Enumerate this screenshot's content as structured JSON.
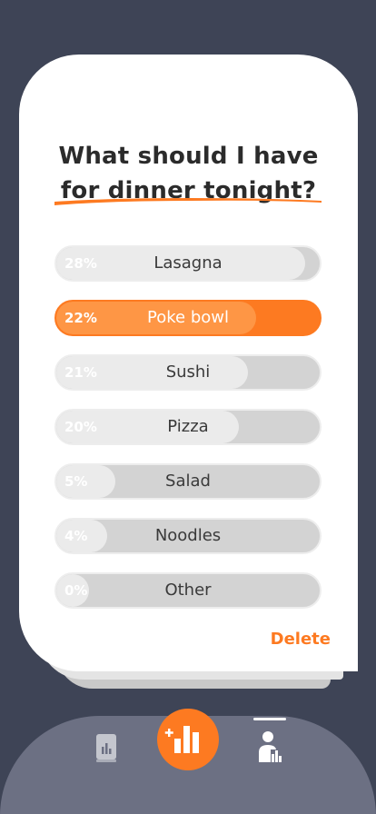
{
  "poll": {
    "question_line1": "What should I have",
    "question_line2": "for dinner tonight?",
    "options": [
      {
        "label": "Lasagna",
        "percent_text": "28%",
        "percent": 28,
        "selected": false
      },
      {
        "label": "Poke bowl",
        "percent_text": "22%",
        "percent": 22,
        "selected": true
      },
      {
        "label": "Sushi",
        "percent_text": "21%",
        "percent": 21,
        "selected": false
      },
      {
        "label": "Pizza",
        "percent_text": "20%",
        "percent": 20,
        "selected": false
      },
      {
        "label": "Salad",
        "percent_text": "5%",
        "percent": 5,
        "selected": false
      },
      {
        "label": "Noodles",
        "percent_text": "4%",
        "percent": 4,
        "selected": false
      },
      {
        "label": "Other",
        "percent_text": "0%",
        "percent": 0,
        "selected": false
      }
    ],
    "delete_label": "Delete"
  },
  "tabbar": {
    "items": [
      {
        "icon": "poll-card-icon",
        "active": false
      },
      {
        "icon": "create-poll-icon",
        "active": false
      },
      {
        "icon": "profile-stats-icon",
        "active": true
      }
    ]
  },
  "colors": {
    "accent": "#fd7a21",
    "background": "#3e4456",
    "tabbar": "#6c7083"
  }
}
